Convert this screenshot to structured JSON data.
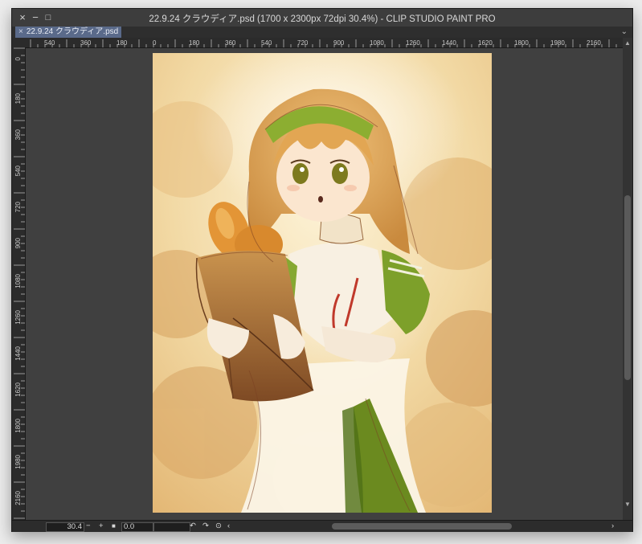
{
  "window": {
    "title": "22.9.24 クラウディア.psd (1700 x 2300px 72dpi 30.4%)  - CLIP STUDIO PAINT PRO",
    "controls": {
      "close": "×",
      "minimize": "−",
      "maximize": "□"
    }
  },
  "tabs": [
    {
      "label": "22.9.24 クラウディア.psd",
      "close": "×"
    }
  ],
  "tab_menu": "⌄",
  "rulers": {
    "horizontal": [
      "540",
      "360",
      "180",
      "0",
      "180",
      "360",
      "540",
      "720",
      "900",
      "1080",
      "1260",
      "1440",
      "1620",
      "1800",
      "1980",
      "2160"
    ],
    "vertical": [
      "0",
      "180",
      "360",
      "540",
      "720",
      "900",
      "1080",
      "1260",
      "1440",
      "1620",
      "1800",
      "1980",
      "2160"
    ]
  },
  "canvas": {
    "description_colors": {
      "background": "#404040",
      "paper": "#f6e6c0"
    }
  },
  "statusbar": {
    "zoom_value": "30.4",
    "zoom_out": "−",
    "zoom_in": "+",
    "fit_icon": "■",
    "rotation_value": "0.0",
    "rotate_left": "↶",
    "rotate_right": "↷",
    "reset_rotation": "⊙",
    "scroll_left": "‹",
    "scroll_right": "›"
  },
  "scroll": {
    "up": "▲",
    "down": "▼"
  }
}
